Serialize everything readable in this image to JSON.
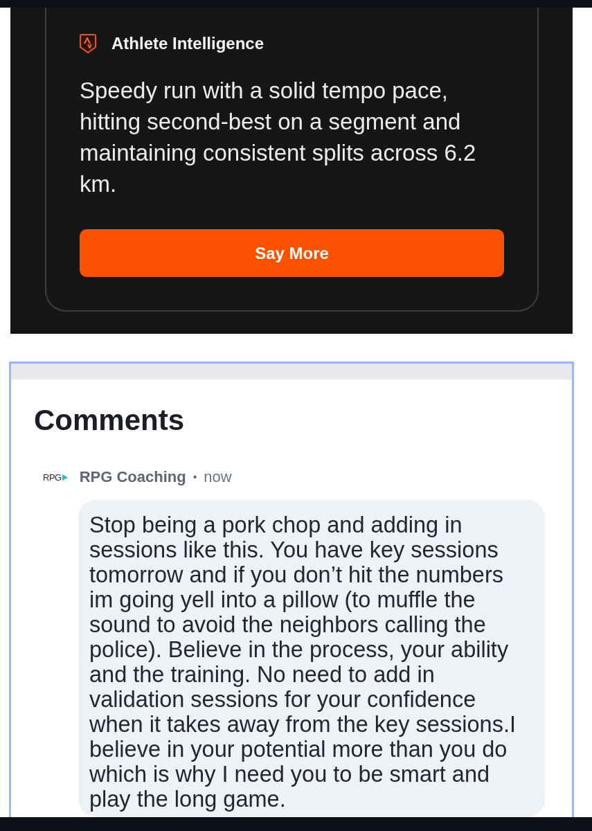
{
  "summary_card": {
    "title": "Athlete Intelligence",
    "text": "Speedy run with a solid tempo pace, hitting second-best on a segment and maintaining consistent splits across 6.2 km.",
    "button": "Say More"
  },
  "comments": {
    "heading": "Comments",
    "items": [
      {
        "logo_text": "RPG",
        "author": "RPG Coaching",
        "separator": "•",
        "time": "now",
        "text": "Stop being a pork chop and adding in sessions like this. You have key sessions tomorrow and if you don’t hit the numbers im going yell into a pillow (to muffle the sound to avoid the neighbors calling the police). Believe in the process, your ability and the training. No need to add in validation sessions for your confidence when it takes away from the key sessions.I believe in your potential more than you do which is why I need you to be smart and play the long game."
      }
    ]
  }
}
